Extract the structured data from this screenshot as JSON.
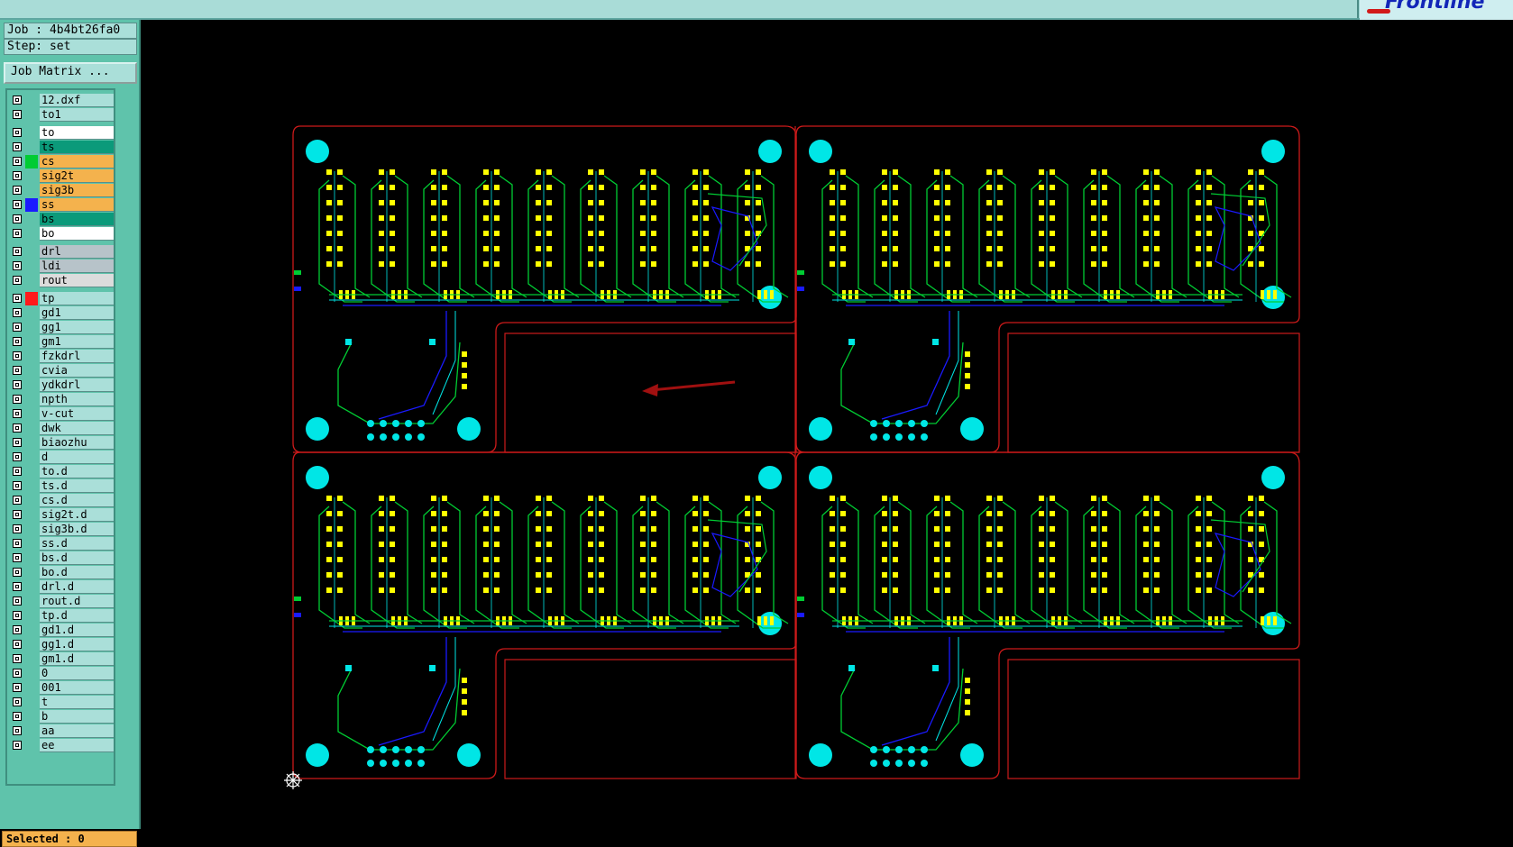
{
  "job": {
    "label": "Job : 4b4bt26fa0",
    "step": "Step: set"
  },
  "job_matrix_label": "Job Matrix ...",
  "logo": "Frontline",
  "selected": "Selected : 0",
  "colors": {
    "accent_green": "#00cc33",
    "route_red": "#cc1a1a",
    "pad_cyan": "#00e6e6",
    "trace_blue": "#1a1aff",
    "trace_yellow": "#ffff00",
    "panel_teal": "#5fc3ab"
  },
  "layer_groups": [
    [
      {
        "name": "12.dxf",
        "bg": "#aadfd9",
        "swatch": ""
      },
      {
        "name": "to1",
        "bg": "#aadfd9",
        "swatch": ""
      }
    ],
    [
      {
        "name": "to",
        "bg": "#ffffff",
        "swatch": ""
      },
      {
        "name": "ts",
        "bg": "#0b9a7a",
        "swatch": ""
      },
      {
        "name": "cs",
        "bg": "#f4b24d",
        "swatch": "#00cc33"
      },
      {
        "name": "sig2t",
        "bg": "#f4b24d",
        "swatch": ""
      },
      {
        "name": "sig3b",
        "bg": "#f4b24d",
        "swatch": ""
      },
      {
        "name": "ss",
        "bg": "#f4b24d",
        "swatch": "#1a1aff"
      },
      {
        "name": "bs",
        "bg": "#0b9a7a",
        "swatch": ""
      },
      {
        "name": "bo",
        "bg": "#ffffff",
        "swatch": ""
      }
    ],
    [
      {
        "name": "drl",
        "bg": "#b7c3c9",
        "swatch": ""
      },
      {
        "name": "ldi",
        "bg": "#b7c3c9",
        "swatch": ""
      },
      {
        "name": "rout",
        "bg": "#dcdcdc",
        "swatch": ""
      }
    ],
    [
      {
        "name": "tp",
        "bg": "#aadfd9",
        "swatch": "#ff1a1a"
      },
      {
        "name": "gd1",
        "bg": "#aadfd9",
        "swatch": ""
      },
      {
        "name": "gg1",
        "bg": "#aadfd9",
        "swatch": ""
      },
      {
        "name": "gm1",
        "bg": "#aadfd9",
        "swatch": ""
      },
      {
        "name": "fzkdrl",
        "bg": "#aadfd9",
        "swatch": ""
      },
      {
        "name": "cvia",
        "bg": "#aadfd9",
        "swatch": ""
      },
      {
        "name": "ydkdrl",
        "bg": "#aadfd9",
        "swatch": ""
      },
      {
        "name": "npth",
        "bg": "#aadfd9",
        "swatch": ""
      },
      {
        "name": "v-cut",
        "bg": "#aadfd9",
        "swatch": ""
      },
      {
        "name": "dwk",
        "bg": "#aadfd9",
        "swatch": ""
      },
      {
        "name": "biaozhu",
        "bg": "#aadfd9",
        "swatch": ""
      },
      {
        "name": "d",
        "bg": "#aadfd9",
        "swatch": ""
      },
      {
        "name": "to.d",
        "bg": "#aadfd9",
        "swatch": ""
      },
      {
        "name": "ts.d",
        "bg": "#aadfd9",
        "swatch": ""
      },
      {
        "name": "cs.d",
        "bg": "#aadfd9",
        "swatch": ""
      },
      {
        "name": "sig2t.d",
        "bg": "#aadfd9",
        "swatch": ""
      },
      {
        "name": "sig3b.d",
        "bg": "#aadfd9",
        "swatch": ""
      },
      {
        "name": "ss.d",
        "bg": "#aadfd9",
        "swatch": ""
      },
      {
        "name": "bs.d",
        "bg": "#aadfd9",
        "swatch": ""
      },
      {
        "name": "bo.d",
        "bg": "#aadfd9",
        "swatch": ""
      },
      {
        "name": "drl.d",
        "bg": "#aadfd9",
        "swatch": ""
      },
      {
        "name": "rout.d",
        "bg": "#aadfd9",
        "swatch": ""
      },
      {
        "name": "tp.d",
        "bg": "#aadfd9",
        "swatch": ""
      },
      {
        "name": "gd1.d",
        "bg": "#aadfd9",
        "swatch": ""
      },
      {
        "name": "gg1.d",
        "bg": "#aadfd9",
        "swatch": ""
      },
      {
        "name": "gm1.d",
        "bg": "#aadfd9",
        "swatch": ""
      },
      {
        "name": "0",
        "bg": "#aadfd9",
        "swatch": ""
      },
      {
        "name": "001",
        "bg": "#aadfd9",
        "swatch": ""
      },
      {
        "name": "t",
        "bg": "#aadfd9",
        "swatch": ""
      },
      {
        "name": "b",
        "bg": "#aadfd9",
        "swatch": ""
      },
      {
        "name": "aa",
        "bg": "#aadfd9",
        "swatch": ""
      },
      {
        "name": "ee",
        "bg": "#aadfd9",
        "swatch": ""
      }
    ]
  ]
}
